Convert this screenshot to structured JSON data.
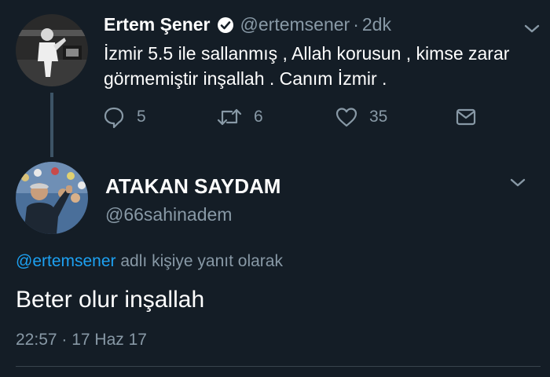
{
  "tweet": {
    "author_name": "Ertem Şener",
    "author_handle": "@ertemsener",
    "separator": "·",
    "time": "2dk",
    "text": "İzmir 5.5 ile sallanmış , Allah korusun , kimse zarar görmemiştir inşallah . Canım İzmir .",
    "actions": {
      "reply_count": "5",
      "retweet_count": "6",
      "like_count": "35"
    }
  },
  "reply": {
    "author_name": "ATAKAN SAYDAM",
    "author_handle": "@66sahinadem",
    "reply_to_mention": "@ertemsener",
    "reply_to_suffix": "adlı kişiye yanıt olarak",
    "text": "Beter olur inşallah",
    "timestamp": "22:57 · 17 Haz 17"
  },
  "colors": {
    "background": "#141d26",
    "secondary_text": "#8899a6",
    "accent": "#1da1f2",
    "thread_line": "#3d5466"
  },
  "icons": {
    "verified": "verified-badge-icon",
    "caret": "chevron-down-icon",
    "reply": "reply-icon",
    "retweet": "retweet-icon",
    "like": "heart-icon",
    "message": "envelope-icon"
  }
}
